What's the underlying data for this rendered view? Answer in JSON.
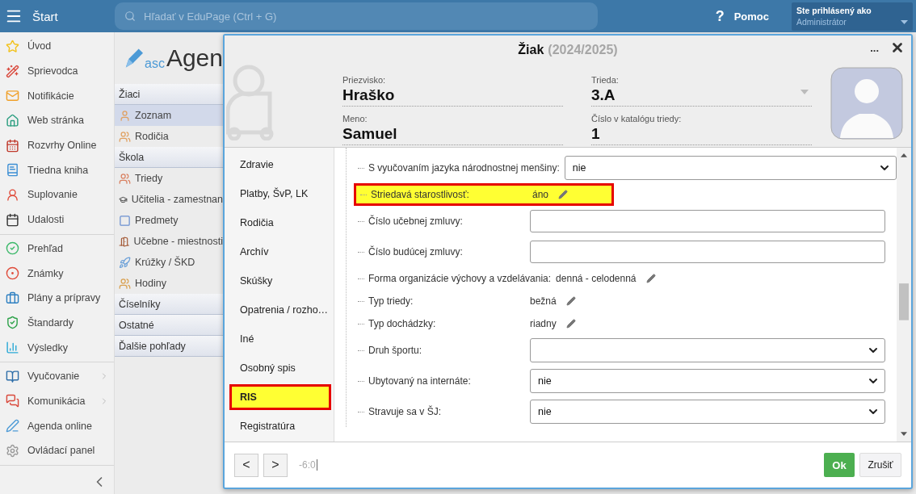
{
  "topbar": {
    "menu_label": "Štart",
    "search_placeholder": "Hľadať v EduPage (Ctrl + G)",
    "help_mark": "?",
    "help_label": "Pomoc",
    "user_caption": "Ste prihlásený ako",
    "user_role": "Administrátor"
  },
  "sidebar": {
    "groups": [
      [
        {
          "label": "Úvod",
          "expandable": false
        },
        {
          "label": "Sprievodca",
          "expandable": false
        },
        {
          "label": "Notifikácie",
          "expandable": false
        },
        {
          "label": "Web stránka",
          "expandable": false
        },
        {
          "label": "Rozvrhy Online",
          "expandable": false
        },
        {
          "label": "Triedna kniha",
          "expandable": false
        },
        {
          "label": "Suplovanie",
          "expandable": false
        },
        {
          "label": "Udalosti",
          "expandable": false
        }
      ],
      [
        {
          "label": "Prehľad",
          "expandable": false
        },
        {
          "label": "Známky",
          "expandable": false
        },
        {
          "label": "Plány a prípravy",
          "expandable": false
        },
        {
          "label": "Štandardy",
          "expandable": false
        },
        {
          "label": "Výsledky",
          "expandable": false
        }
      ],
      [
        {
          "label": "Vyučovanie",
          "expandable": true
        },
        {
          "label": "Komunikácia",
          "expandable": true
        },
        {
          "label": "Agenda online",
          "expandable": false
        },
        {
          "label": "Ovládací panel",
          "expandable": false
        }
      ]
    ]
  },
  "agenda_panel": {
    "logo": {
      "prefix": "asc",
      "name": "Agen"
    },
    "sections": [
      {
        "title": "Žiaci",
        "items": [
          {
            "label": "Zoznam",
            "selected": true
          },
          {
            "label": "Rodičia",
            "selected": false
          }
        ]
      },
      {
        "title": "Škola",
        "items": [
          {
            "label": "Triedy",
            "selected": false
          },
          {
            "label": "Učitelia - zamestnan",
            "selected": false
          },
          {
            "label": "Predmety",
            "selected": false
          },
          {
            "label": "Učebne - miestnosti",
            "selected": false
          },
          {
            "label": "Krúžky / ŠKD",
            "selected": false
          },
          {
            "label": "Hodiny",
            "selected": false
          }
        ]
      },
      {
        "title": "Číselníky"
      },
      {
        "title": "Ostatné"
      },
      {
        "title": "Ďalšie pohľady"
      }
    ]
  },
  "dialog": {
    "title": "Žiak",
    "year": "(2024/2025)",
    "more": "...",
    "fields": [
      {
        "label": "Priezvisko:",
        "value": "Hraško",
        "kind": "text"
      },
      {
        "label": "Trieda:",
        "value": "3.A",
        "kind": "select"
      },
      {
        "label": "Meno:",
        "value": "Samuel",
        "kind": "text"
      },
      {
        "label": "Číslo v katalógu triedy:",
        "value": "1",
        "kind": "text"
      }
    ],
    "tabs": [
      {
        "label": "Zdravie",
        "selected": false
      },
      {
        "label": "Platby, ŠvP, LK",
        "selected": false
      },
      {
        "label": "Rodičia",
        "selected": false
      },
      {
        "label": "Archív",
        "selected": false
      },
      {
        "label": "Skúšky",
        "selected": false
      },
      {
        "label": "Opatrenia / rozho…",
        "selected": false
      },
      {
        "label": "Iné",
        "selected": false
      },
      {
        "label": "Osobný spis",
        "selected": false
      },
      {
        "label": "RIS",
        "selected": true
      },
      {
        "label": "Registratúra",
        "selected": false
      }
    ],
    "rows": [
      {
        "label": "S vyučovaním jazyka národnostnej menšiny:",
        "kind": "select",
        "value": "nie",
        "highlighted": false
      },
      {
        "label": "Striedavá starostlivosť:",
        "kind": "text",
        "value": "áno",
        "highlighted": true
      },
      {
        "label": "Číslo učebnej zmluvy:",
        "kind": "input",
        "highlighted": false
      },
      {
        "label": "Číslo budúcej zmluvy:",
        "kind": "input",
        "highlighted": false
      },
      {
        "label": "Forma organizácie výchovy a vzdelávania:",
        "kind": "text",
        "value": "denná - celodenná",
        "highlighted": false
      },
      {
        "label": "Typ triedy:",
        "kind": "text",
        "value": "bežná",
        "highlighted": false
      },
      {
        "label": "Typ dochádzky:",
        "kind": "text",
        "value": "riadny",
        "highlighted": false
      },
      {
        "label": "Druh športu:",
        "kind": "select",
        "highlighted": false
      },
      {
        "label": "Ubytovaný na internáte:",
        "kind": "select",
        "value": "nie",
        "highlighted": false
      },
      {
        "label": "Stravuje sa v ŠJ:",
        "kind": "select",
        "value": "nie",
        "highlighted": false
      }
    ],
    "footer": {
      "prev": "<",
      "next": ">",
      "input_value": "-6:0",
      "ok": "Ok",
      "cancel": "Zrušiť"
    }
  }
}
